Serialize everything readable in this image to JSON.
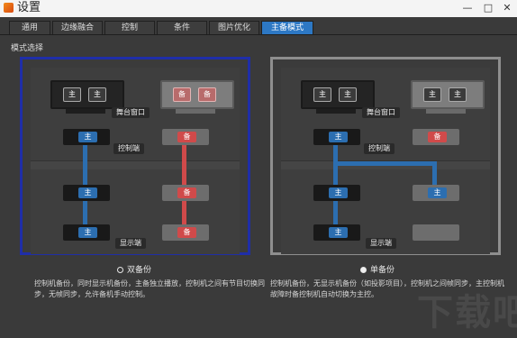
{
  "window": {
    "title": "设置",
    "min": "—",
    "max": "□",
    "close": "✕"
  },
  "tabs": [
    {
      "label": "通用",
      "active": false
    },
    {
      "label": "边缘融合",
      "active": false
    },
    {
      "label": "控制",
      "active": false
    },
    {
      "label": "条件",
      "active": false
    },
    {
      "label": "图片优化",
      "active": false
    },
    {
      "label": "主备模式",
      "active": true
    }
  ],
  "section_title": "模式选择",
  "cards": {
    "dual": {
      "stage_label": "舞台窗口",
      "control_label": "控制端",
      "display_label": "显示端",
      "monitor_main": [
        "主",
        "主"
      ],
      "monitor_backup": [
        "备",
        "备"
      ],
      "chip_main": "主",
      "chip_backup": "备"
    },
    "single": {
      "stage_label": "舞台窗口",
      "control_label": "控制端",
      "display_label": "显示端",
      "monitor_main": [
        "主",
        "主"
      ],
      "monitor_backup": [
        "主",
        "主"
      ],
      "chip_main": "主",
      "chip_backup": "备"
    }
  },
  "options": {
    "dual": {
      "label": "双备份",
      "selected": false,
      "description": "控制机备份，同时显示机备份，主备独立播放，控制机之间有节目切换同步，无帧同步，允许备机手动控制。"
    },
    "single": {
      "label": "单备份",
      "selected": true,
      "description": "控制机备份，无显示机备份（如投影项目），控制机之间帧同步，主控制机故障时备控制机自动切换为主控。"
    }
  },
  "colors": {
    "accent": "#2d78c4",
    "selected_border": "#1f2ea8",
    "unselected_border": "#8e8e8e",
    "main_chip": "#2c6eb0",
    "backup_chip": "#d04a4a"
  },
  "watermark": "下载吧"
}
